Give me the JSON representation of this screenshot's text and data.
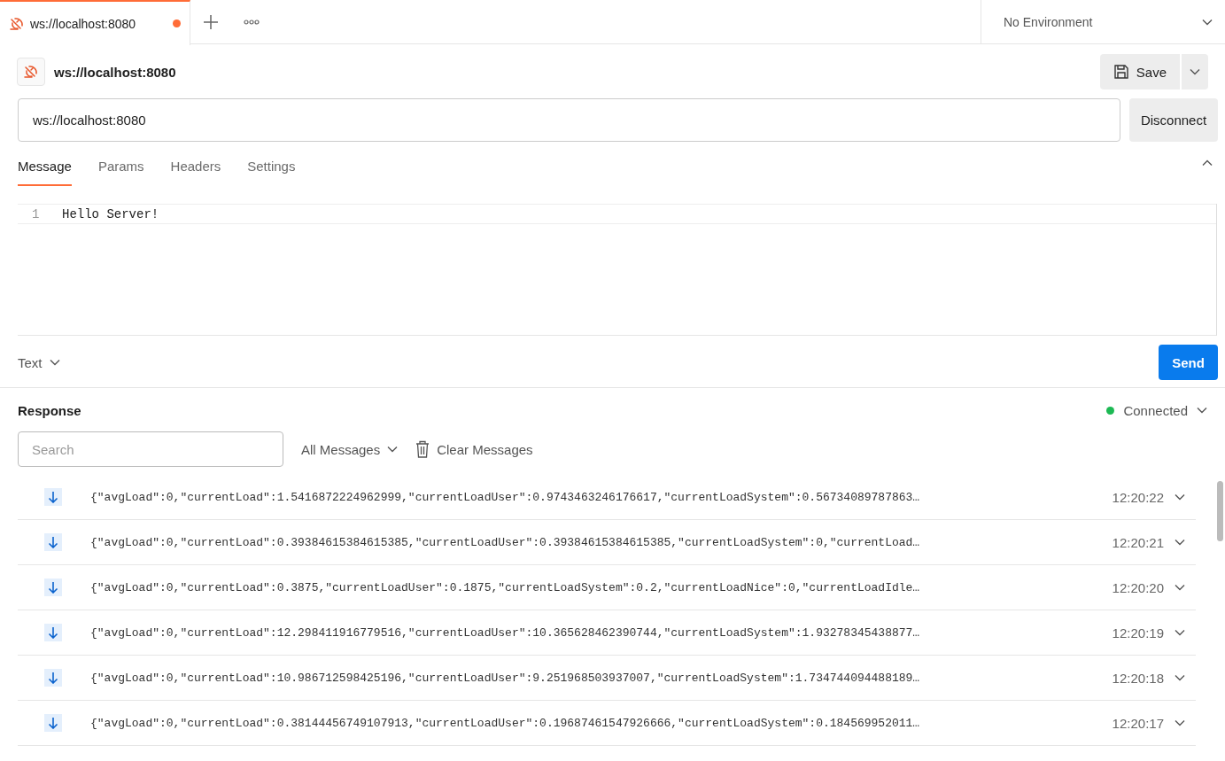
{
  "tabs": [
    {
      "label": "ws://localhost:8080",
      "selected": true,
      "unsaved": true
    }
  ],
  "environment": {
    "value": "No Environment"
  },
  "request": {
    "title": "ws://localhost:8080",
    "url": "ws://localhost:8080",
    "save_label": "Save",
    "connect_label": "Disconnect"
  },
  "editor_tabs": [
    {
      "label": "Message",
      "selected": true
    },
    {
      "label": "Params",
      "selected": false
    },
    {
      "label": "Headers",
      "selected": false
    },
    {
      "label": "Settings",
      "selected": false
    }
  ],
  "editor": {
    "lines": [
      {
        "number": "1",
        "text": "Hello Server!"
      }
    ],
    "format": "Text",
    "send_label": "Send"
  },
  "response": {
    "title": "Response",
    "status": {
      "label": "Connected",
      "connected": true
    },
    "search_placeholder": "Search",
    "filter": "All Messages",
    "clear_label": "Clear Messages",
    "messages": [
      {
        "text": "{\"avgLoad\":0,\"currentLoad\":1.5416872224962999,\"currentLoadUser\":0.9743463246176617,\"currentLoadSystem\":0.56734089787863…",
        "time": "12:20:22"
      },
      {
        "text": "{\"avgLoad\":0,\"currentLoad\":0.39384615384615385,\"currentLoadUser\":0.39384615384615385,\"currentLoadSystem\":0,\"currentLoad…",
        "time": "12:20:21"
      },
      {
        "text": "{\"avgLoad\":0,\"currentLoad\":0.3875,\"currentLoadUser\":0.1875,\"currentLoadSystem\":0.2,\"currentLoadNice\":0,\"currentLoadIdle…",
        "time": "12:20:20"
      },
      {
        "text": "{\"avgLoad\":0,\"currentLoad\":12.298411916779516,\"currentLoadUser\":10.365628462390744,\"currentLoadSystem\":1.93278345438877…",
        "time": "12:20:19"
      },
      {
        "text": "{\"avgLoad\":0,\"currentLoad\":10.986712598425196,\"currentLoadUser\":9.251968503937007,\"currentLoadSystem\":1.734744094488189…",
        "time": "12:20:18"
      },
      {
        "text": "{\"avgLoad\":0,\"currentLoad\":0.38144456749107913,\"currentLoadUser\":0.19687461547926666,\"currentLoadSystem\":0.184569952011…",
        "time": "12:20:17"
      }
    ]
  }
}
